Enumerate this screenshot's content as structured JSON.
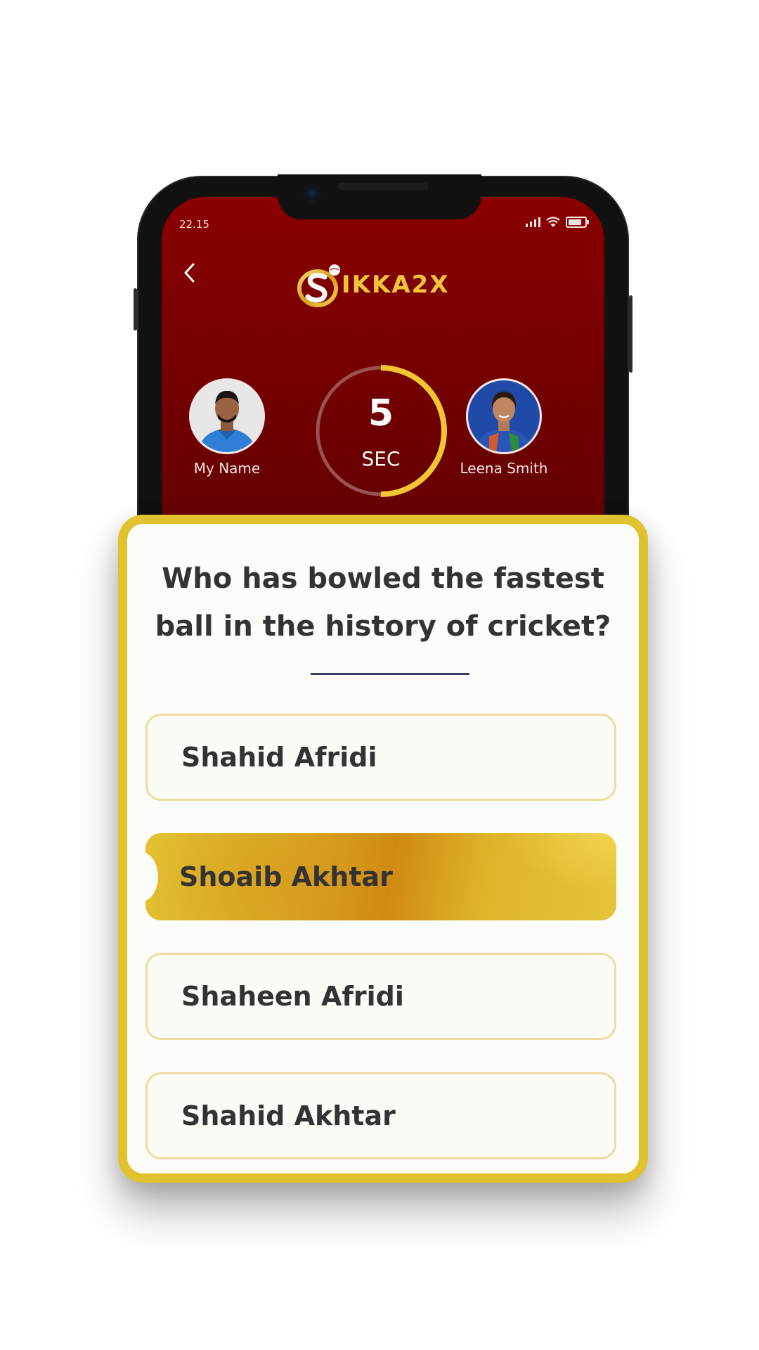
{
  "status_bar": {
    "time": "22.15"
  },
  "header": {
    "logo_text": "IKKA2X"
  },
  "players": {
    "left": {
      "name": "My Name"
    },
    "right": {
      "name": "Leena Smith"
    }
  },
  "timer": {
    "value": "5",
    "unit": "SEC",
    "progress_fraction": 0.5
  },
  "question": {
    "text": "Who has bowled the fastest ball in the history of cricket?"
  },
  "options": [
    {
      "label": "Shahid Afridi",
      "selected": false
    },
    {
      "label": "Shoaib Akhtar",
      "selected": true
    },
    {
      "label": "Shaheen Afridi",
      "selected": false
    },
    {
      "label": "Shahid Akhtar",
      "selected": false
    }
  ],
  "colors": {
    "header_red": "#8a0000",
    "accent_gold": "#e0c12e",
    "timer_ring": "#f2c531"
  }
}
